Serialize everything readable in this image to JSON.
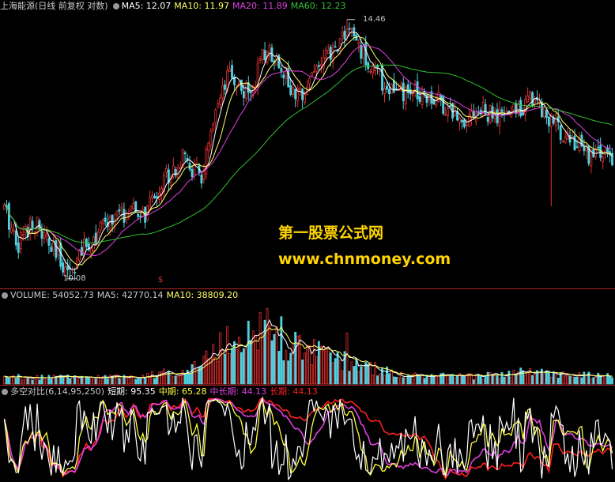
{
  "colors": {
    "background": "#000000",
    "up": "#e03030",
    "down": "#4fd0e0",
    "ma5": "#ffffff",
    "ma10": "#ffff66",
    "ma20": "#e040e0",
    "ma60": "#30c030",
    "separator": "#b02020",
    "short": "#ffffff",
    "mid": "#ffff40",
    "midlong": "#e040e0",
    "long": "#ff2020",
    "watermark": "#ffd400"
  },
  "price_panel": {
    "title": "上海能源(日线 前复权 对数)",
    "ma5": "MA5: 12.07",
    "ma10": "MA10: 11.97",
    "ma20": "MA20: 11.89",
    "ma60": "MA60: 12.23",
    "high_label": "14.46",
    "low_label": "10.08",
    "marker": "$"
  },
  "volume_panel": {
    "vol": "VOLUME: 54052.73",
    "ma5": "MA5: 42770.14",
    "ma10": "MA10: 38809.20"
  },
  "indicator_panel": {
    "title": "多空对比(6,14,95,250)",
    "short": "短期: 95.35",
    "mid": "中期: 65.28",
    "midlong": "中长期: 44.13",
    "long": "长期: 44.13"
  },
  "watermark": {
    "line1": "第一股票公式网",
    "line2": "www.chnmoney.com"
  },
  "chart_data": {
    "type": "candlestick",
    "price_range": [
      10.0,
      14.6
    ],
    "max_price": 14.46,
    "min_price": 10.08,
    "price_anchors": [
      [
        0,
        11.1
      ],
      [
        6,
        10.6
      ],
      [
        12,
        10.95
      ],
      [
        20,
        10.5
      ],
      [
        28,
        10.2
      ],
      [
        36,
        10.6
      ],
      [
        44,
        10.9
      ],
      [
        52,
        11.05
      ],
      [
        60,
        11.0
      ],
      [
        68,
        11.6
      ],
      [
        76,
        11.9
      ],
      [
        84,
        11.6
      ],
      [
        90,
        12.6
      ],
      [
        96,
        13.4
      ],
      [
        104,
        13.0
      ],
      [
        112,
        13.9
      ],
      [
        118,
        13.6
      ],
      [
        124,
        12.9
      ],
      [
        132,
        13.5
      ],
      [
        140,
        13.8
      ],
      [
        146,
        14.3
      ],
      [
        154,
        13.7
      ],
      [
        162,
        13.2
      ],
      [
        170,
        13.0
      ],
      [
        178,
        13.1
      ],
      [
        186,
        12.9
      ],
      [
        194,
        12.6
      ],
      [
        202,
        12.75
      ],
      [
        210,
        12.6
      ],
      [
        218,
        12.75
      ],
      [
        226,
        13.0
      ],
      [
        232,
        12.6
      ],
      [
        240,
        12.3
      ],
      [
        248,
        12.0
      ],
      [
        256,
        12.0
      ],
      [
        260,
        11.7
      ]
    ],
    "volume_range": [
      0,
      100000
    ],
    "volume_anchors": [
      [
        0,
        8000
      ],
      [
        40,
        8000
      ],
      [
        60,
        10000
      ],
      [
        80,
        18000
      ],
      [
        92,
        45000
      ],
      [
        100,
        55000
      ],
      [
        108,
        68000
      ],
      [
        116,
        55000
      ],
      [
        124,
        45000
      ],
      [
        132,
        38000
      ],
      [
        140,
        32000
      ],
      [
        150,
        24000
      ],
      [
        170,
        10000
      ],
      [
        200,
        9000
      ],
      [
        220,
        14000
      ],
      [
        240,
        11000
      ],
      [
        260,
        9000
      ]
    ],
    "indicator_range": [
      0,
      100
    ],
    "indicator_series": [
      {
        "name": "短期",
        "value": 95.35
      },
      {
        "name": "中期",
        "value": 65.28
      },
      {
        "name": "中长期",
        "value": 44.13
      },
      {
        "name": "长期",
        "value": 44.13
      }
    ]
  }
}
